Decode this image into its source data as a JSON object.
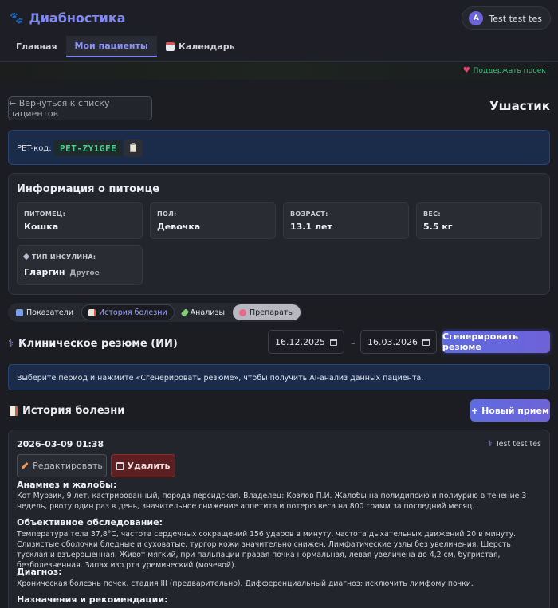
{
  "app": {
    "title": "Диабностика"
  },
  "user": {
    "initial": "A",
    "name": "Test test tes"
  },
  "nav": {
    "items": [
      {
        "label": "Главная"
      },
      {
        "label": "Мои пациенты"
      },
      {
        "label": "Календарь"
      }
    ]
  },
  "support": {
    "label": "Поддержать проект"
  },
  "back_button": "← Вернуться к списку пациентов",
  "pet_name": "Ушастик",
  "pet_code": {
    "label": "PET-код:",
    "value": "PET-ZY1GFE"
  },
  "info": {
    "title": "Информация о питомце",
    "fields": [
      {
        "label": "ПИТОМЕЦ:",
        "value": "Кошка"
      },
      {
        "label": "ПОЛ:",
        "value": "Девочка"
      },
      {
        "label": "ВОЗРАСТ:",
        "value": "13.1 лет"
      },
      {
        "label": "ВЕС:",
        "value": "5.5 кг"
      }
    ],
    "insulin": {
      "label": "ТИП ИНСУЛИНА:",
      "value": "Гларгин",
      "sub": "Другое"
    }
  },
  "tabs": [
    {
      "label": "Показатели"
    },
    {
      "label": "История болезни"
    },
    {
      "label": "Анализы"
    },
    {
      "label": "Препараты"
    }
  ],
  "clinical": {
    "title": "Клиническое резюме (ИИ)",
    "date_from": "16.12.2025",
    "date_to": "16.03.2026",
    "separator": "–",
    "generate_label": "Сгенерировать резюме",
    "hint": "Выберите период и нажмите «Сгенерировать резюме», чтобы получить AI-анализ данных пациента."
  },
  "history": {
    "title": "История болезни",
    "new_label": "+ Новый прием",
    "entry": {
      "datetime": "2026-03-09 01:38",
      "author": "Test test tes",
      "edit_label": "Редактировать",
      "delete_label": "Удалить",
      "anamnesis_title": "Анамнез и жалобы:",
      "anamnesis_text": "Кот Мурзик, 9 лет, кастрированный, порода персидская. Владелец: Козлов П.И. Жалобы на полидипсию и полиурию в течение 3 недель, рвоту один раз в день, значительное снижение аппетита и потерю веса на 800 грамм за последний месяц.",
      "exam_title": "Объективное обследование:",
      "exam_text": "Температура тела 37,8°С, частота сердечных сокращений 156 ударов в минуту, частота дыхательных движений 20 в минуту. Слизистые оболочки бледные и суховатые, тургор кожи значительно снижен. Лимфатические узлы без увеличения. Шерсть тусклая и взъерошенная. Живот мягкий, при пальпации правая почка нормальная, левая увеличена до 4,2 см, бугристая, безболезненная. Запах изо рта уремический (мочевой).",
      "diagnosis_title": "Диагноз:",
      "diagnosis_text": "Хроническая болезнь почек, стадия III (предварительно). Дифференциальный диагноз: исключить лимфому почки.",
      "treatment_title": "Назначения и рекомендации:"
    }
  }
}
